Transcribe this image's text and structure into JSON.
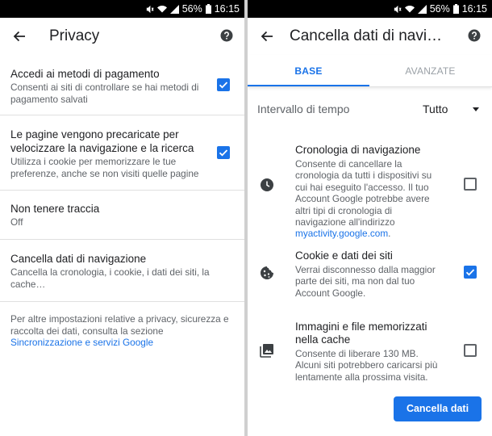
{
  "status_bar": {
    "battery": "56%",
    "time": "16:15"
  },
  "left": {
    "title": "Privacy",
    "items": [
      {
        "title": "Accedi ai metodi di pagamento",
        "subtitle": "Consenti ai siti di controllare se hai metodi di pagamento salvati",
        "checked": true
      },
      {
        "title": "Le pagine vengono precaricate per velocizzare la navigazione e la ricerca",
        "subtitle": "Utilizza i cookie per memorizzare le tue preferenze, anche se non visiti quelle pagine",
        "checked": true
      },
      {
        "title": "Non tenere traccia",
        "subtitle": "Off"
      },
      {
        "title": "Cancella dati di navigazione",
        "subtitle": "Cancella la cronologia, i cookie, i dati dei siti, la cache…"
      }
    ],
    "footer_text": "Per altre impostazioni relative a privacy, sicurezza e raccolta dei dati, consulta la sezione",
    "footer_link": "Sincronizzazione e servizi Google"
  },
  "right": {
    "title": "Cancella dati di navigazione",
    "tabs": [
      "BASE",
      "AVANZATE"
    ],
    "interval_label": "Intervallo di tempo",
    "interval_value": "Tutto",
    "items": [
      {
        "icon": "clock-icon",
        "title": "Cronologia di navigazione",
        "subtitle": "Consente di cancellare la cronologia da tutti i dispositivi su cui hai eseguito l'accesso. Il tuo Account Google potrebbe avere altri tipi di cronologia di navigazione all'indirizzo",
        "link": "myactivity.google.com",
        "link_suffix": ".",
        "checked": false
      },
      {
        "icon": "cookie-icon",
        "title": "Cookie e dati dei siti",
        "subtitle": "Verrai disconnesso dalla maggior parte dei siti, ma non dal tuo Account Google.",
        "checked": true
      },
      {
        "icon": "image-icon",
        "title": "Immagini e file memorizzati nella cache",
        "subtitle": "Consente di liberare 130 MB. Alcuni siti potrebbero caricarsi più lentamente alla prossima visita.",
        "checked": false
      }
    ],
    "button_label": "Cancella dati"
  },
  "colors": {
    "accent": "#1a73e8",
    "text": "#202124",
    "secondary": "#5f6368"
  }
}
